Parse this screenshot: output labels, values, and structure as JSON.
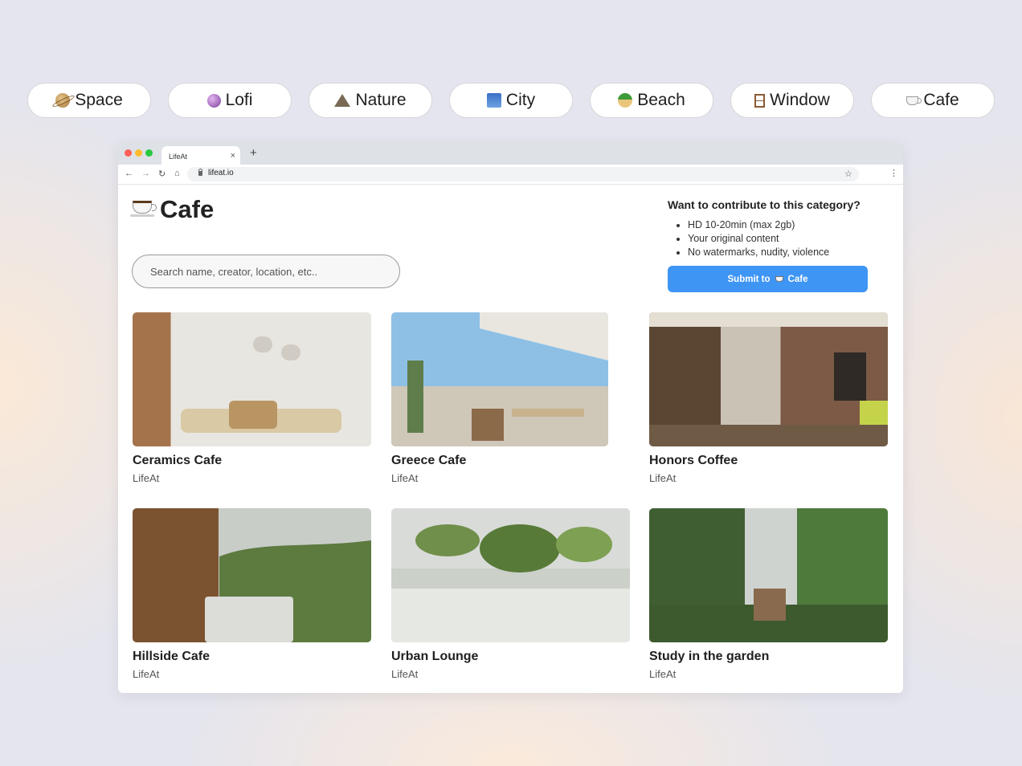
{
  "categories": [
    {
      "label": "Space",
      "icon": "ringed-planet-icon"
    },
    {
      "label": "Lofi",
      "icon": "crystal-ball-icon"
    },
    {
      "label": "Nature",
      "icon": "mountain-icon"
    },
    {
      "label": "City",
      "icon": "cityscape-icon"
    },
    {
      "label": "Beach",
      "icon": "desert-island-icon"
    },
    {
      "label": "Window",
      "icon": "window-icon"
    },
    {
      "label": "Cafe",
      "icon": "coffee-cup-icon"
    }
  ],
  "browser": {
    "tab_title": "LifeAt",
    "tab_close": "×",
    "new_tab": "+",
    "url": "lifeat.io",
    "nav": {
      "back": "←",
      "forward": "→",
      "reload": "↻",
      "home": "⌂",
      "bookmark": "☆",
      "menu": "⋮"
    }
  },
  "page": {
    "title": "Cafe",
    "search_placeholder": "Search name, creator, location, etc..",
    "contribute": {
      "heading": "Want to contribute to this category?",
      "requirements": [
        "HD 10-20min (max 2gb)",
        "Your original content",
        "No watermarks, nudity, violence"
      ],
      "submit_prefix": "Submit to",
      "submit_category": "Cafe",
      "submit_color": "#3e95f4"
    },
    "items": [
      {
        "title": "Ceramics Cafe",
        "creator": "LifeAt"
      },
      {
        "title": "Greece Cafe",
        "creator": "LifeAt"
      },
      {
        "title": "Honors Coffee",
        "creator": "LifeAt"
      },
      {
        "title": "Hillside Cafe",
        "creator": "LifeAt"
      },
      {
        "title": "Urban Lounge",
        "creator": "LifeAt"
      },
      {
        "title": "Study in the garden",
        "creator": "LifeAt"
      }
    ]
  },
  "colors": {
    "traffic_red": "#ff5f57",
    "traffic_yellow": "#febc2e",
    "traffic_green": "#28c840"
  }
}
